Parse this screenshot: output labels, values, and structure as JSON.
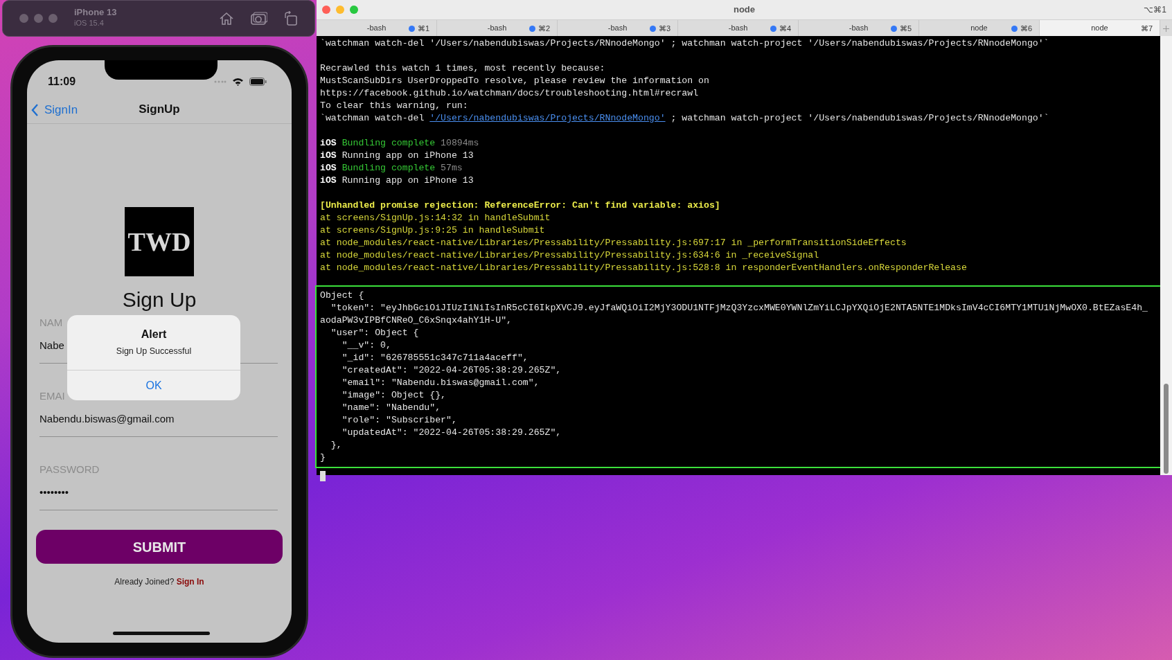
{
  "simulator": {
    "title": "iPhone 13",
    "subtitle": "iOS 15.4"
  },
  "phone": {
    "status_time": "11:09",
    "nav": {
      "back": "SignIn",
      "title": "SignUp"
    },
    "logo": "TWD",
    "heading": "Sign Up",
    "fields": [
      {
        "label": "NAM",
        "value": "Nabe"
      },
      {
        "label": "EMAI",
        "value": "Nabendu.biswas@gmail.com"
      },
      {
        "label": "PASSWORD",
        "value": "••••••••"
      }
    ],
    "submit": "SUBMIT",
    "footer": {
      "text": "Already Joined?",
      "link": "Sign In"
    },
    "alert": {
      "title": "Alert",
      "message": "Sign Up Successful",
      "button": "OK"
    }
  },
  "terminal": {
    "title": "node",
    "shortcut": "⌥⌘1",
    "tabs": [
      {
        "label": "-bash",
        "shortcut": "⌘1",
        "activity": true,
        "selected": false
      },
      {
        "label": "-bash",
        "shortcut": "⌘2",
        "activity": true,
        "selected": false
      },
      {
        "label": "-bash",
        "shortcut": "⌘3",
        "activity": true,
        "selected": false
      },
      {
        "label": "-bash",
        "shortcut": "⌘4",
        "activity": true,
        "selected": false
      },
      {
        "label": "-bash",
        "shortcut": "⌘5",
        "activity": true,
        "selected": false
      },
      {
        "label": "node",
        "shortcut": "⌘6",
        "activity": true,
        "selected": false
      },
      {
        "label": "node",
        "shortcut": "⌘7",
        "activity": false,
        "selected": true
      }
    ],
    "blocks": [
      {
        "highlighted": false,
        "lines": [
          [
            {
              "kind": "plain",
              "text": "`watchman watch-del '/Users/nabendubiswas/Projects/RNnodeMongo' ; watchman watch-project '/Users/nabendubiswas/Projects/RNnodeMongo'`"
            }
          ]
        ]
      },
      {
        "highlighted": false,
        "lines": [
          [
            {
              "kind": "plain",
              "text": "Recrawled this watch 1 times, most recently because:"
            }
          ],
          [
            {
              "kind": "plain",
              "text": "MustScanSubDirs UserDroppedTo resolve, please review the information on"
            }
          ],
          [
            {
              "kind": "plain",
              "text": "https://facebook.github.io/watchman/docs/troubleshooting.html#recrawl"
            }
          ],
          [
            {
              "kind": "plain",
              "text": "To clear this warning, run:"
            }
          ],
          [
            {
              "kind": "plain",
              "text": "`watchman watch-del "
            },
            {
              "kind": "link",
              "text": "'/Users/nabendubiswas/Projects/RNnodeMongo'"
            },
            {
              "kind": "plain",
              "text": " ; watchman watch-project '/Users/nabendubiswas/Projects/RNnodeMongo'`"
            }
          ]
        ]
      },
      {
        "highlighted": false,
        "lines": [
          [
            {
              "kind": "bold",
              "text": "iOS"
            },
            {
              "kind": "green",
              "text": " Bundling complete"
            },
            {
              "kind": "dim",
              "text": " 10894ms"
            }
          ],
          [
            {
              "kind": "bold",
              "text": "iOS"
            },
            {
              "kind": "plain",
              "text": " Running app on iPhone 13"
            }
          ],
          [
            {
              "kind": "bold",
              "text": "iOS"
            },
            {
              "kind": "green",
              "text": " Bundling complete"
            },
            {
              "kind": "dim",
              "text": " 57ms"
            }
          ],
          [
            {
              "kind": "bold",
              "text": "iOS"
            },
            {
              "kind": "plain",
              "text": " Running app on iPhone 13"
            }
          ]
        ]
      },
      {
        "highlighted": false,
        "lines": [
          [
            {
              "kind": "error",
              "text": "[Unhandled promise rejection: ReferenceError: Can't find variable: axios]"
            }
          ],
          [
            {
              "kind": "trace",
              "text": "at screens/SignUp.js:14:32 in handleSubmit"
            }
          ],
          [
            {
              "kind": "trace",
              "text": "at screens/SignUp.js:9:25 in handleSubmit"
            }
          ],
          [
            {
              "kind": "trace",
              "text": "at node_modules/react-native/Libraries/Pressability/Pressability.js:697:17 in _performTransitionSideEffects"
            }
          ],
          [
            {
              "kind": "trace",
              "text": "at node_modules/react-native/Libraries/Pressability/Pressability.js:634:6 in _receiveSignal"
            }
          ],
          [
            {
              "kind": "trace",
              "text": "at node_modules/react-native/Libraries/Pressability/Pressability.js:528:8 in responderEventHandlers.onResponderRelease"
            }
          ]
        ]
      },
      {
        "highlighted": true,
        "lines": [
          [
            {
              "kind": "plain",
              "text": "Object {"
            }
          ],
          [
            {
              "kind": "plain",
              "text": "  \"token\": \"eyJhbGciOiJIUzI1NiIsInR5cCI6IkpXVCJ9.eyJfaWQiOiI2MjY3ODU1NTFjMzQ3YzcxMWE0YWNlZmYiLCJpYXQiOjE2NTA5NTE1MDksImV4cCI6MTY1MTU1NjMwOX0.BtEZasE4h_"
            }
          ],
          [
            {
              "kind": "plain",
              "text": "aodaPW3vIPBfCNReO_C6xSnqx4ahY1H-U\","
            }
          ],
          [
            {
              "kind": "plain",
              "text": "  \"user\": Object {"
            }
          ],
          [
            {
              "kind": "plain",
              "text": "    \"__v\": 0,"
            }
          ],
          [
            {
              "kind": "plain",
              "text": "    \"_id\": \"626785551c347c711a4aceff\","
            }
          ],
          [
            {
              "kind": "plain",
              "text": "    \"createdAt\": \"2022-04-26T05:38:29.265Z\","
            }
          ],
          [
            {
              "kind": "plain",
              "text": "    \"email\": \"Nabendu.biswas@gmail.com\","
            }
          ],
          [
            {
              "kind": "plain",
              "text": "    \"image\": Object {},"
            }
          ],
          [
            {
              "kind": "plain",
              "text": "    \"name\": \"Nabendu\","
            }
          ],
          [
            {
              "kind": "plain",
              "text": "    \"role\": \"Subscriber\","
            }
          ],
          [
            {
              "kind": "plain",
              "text": "    \"updatedAt\": \"2022-04-26T05:38:29.265Z\","
            }
          ],
          [
            {
              "kind": "plain",
              "text": "  },"
            }
          ],
          [
            {
              "kind": "plain",
              "text": "}"
            }
          ]
        ]
      }
    ]
  }
}
